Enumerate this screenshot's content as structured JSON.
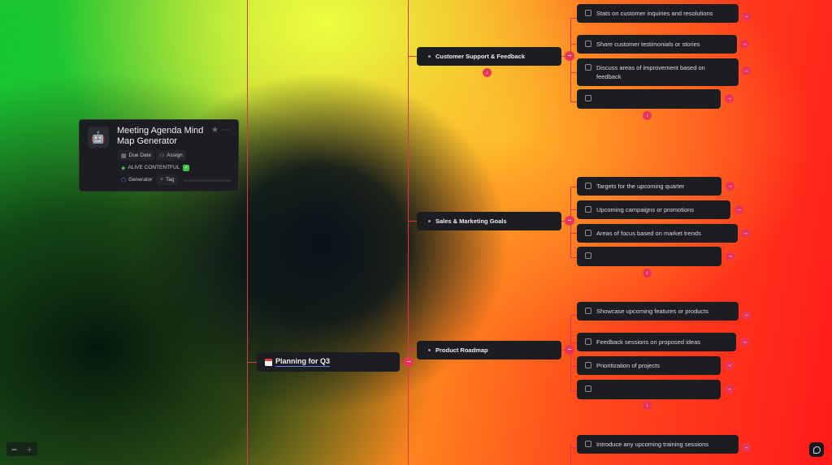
{
  "project": {
    "title": "Meeting Agenda Mind Map Generator",
    "avatar_icon": "robot-icon",
    "due_date_label": "Due Date",
    "assign_label": "Assign",
    "status_tag": "ALIVE CONTENTFUL",
    "status_emoji": "check-mark-icon",
    "generator_tag": "Generator",
    "add_tag_label": "Tag"
  },
  "root": {
    "label": "Planning for Q3",
    "icon": "calendar-icon"
  },
  "branches": [
    {
      "label": "Customer Support & Feedback",
      "items": [
        "Stats on customer inquiries and resolutions",
        "Share customer testimonials or stories",
        "Discuss areas of improvement based on feedback",
        ""
      ]
    },
    {
      "label": "Sales & Marketing Goals",
      "items": [
        "Targets for the upcoming quarter",
        "Upcoming campaigns or promotions",
        "Areas of focus based on market trends",
        ""
      ]
    },
    {
      "label": "Product Roadmap",
      "items": [
        "Showcase upcoming features or products",
        "Feedback sessions on proposed ideas",
        "Prioritization of projects",
        ""
      ]
    },
    {
      "label": "",
      "items": [
        "Introduce any upcoming training sessions"
      ]
    }
  ],
  "controls": {
    "zoom_out": "−",
    "zoom_in": "+"
  },
  "colors": {
    "accent": "#e8345a",
    "node_bg": "#1c1d21",
    "connector": "#e0344e"
  }
}
